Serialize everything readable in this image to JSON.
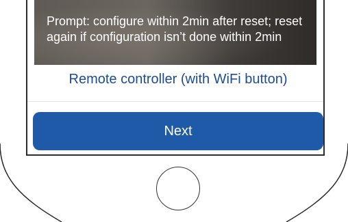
{
  "prompt": {
    "text": "Prompt: configure within 2min after reset; reset again if configuration isn’t done within 2min"
  },
  "option": {
    "label": "Remote controller (with WiFi button)"
  },
  "actions": {
    "next_label": "Next"
  },
  "colors": {
    "accent": "#1f5aa8",
    "link_text": "#1b4c96"
  }
}
